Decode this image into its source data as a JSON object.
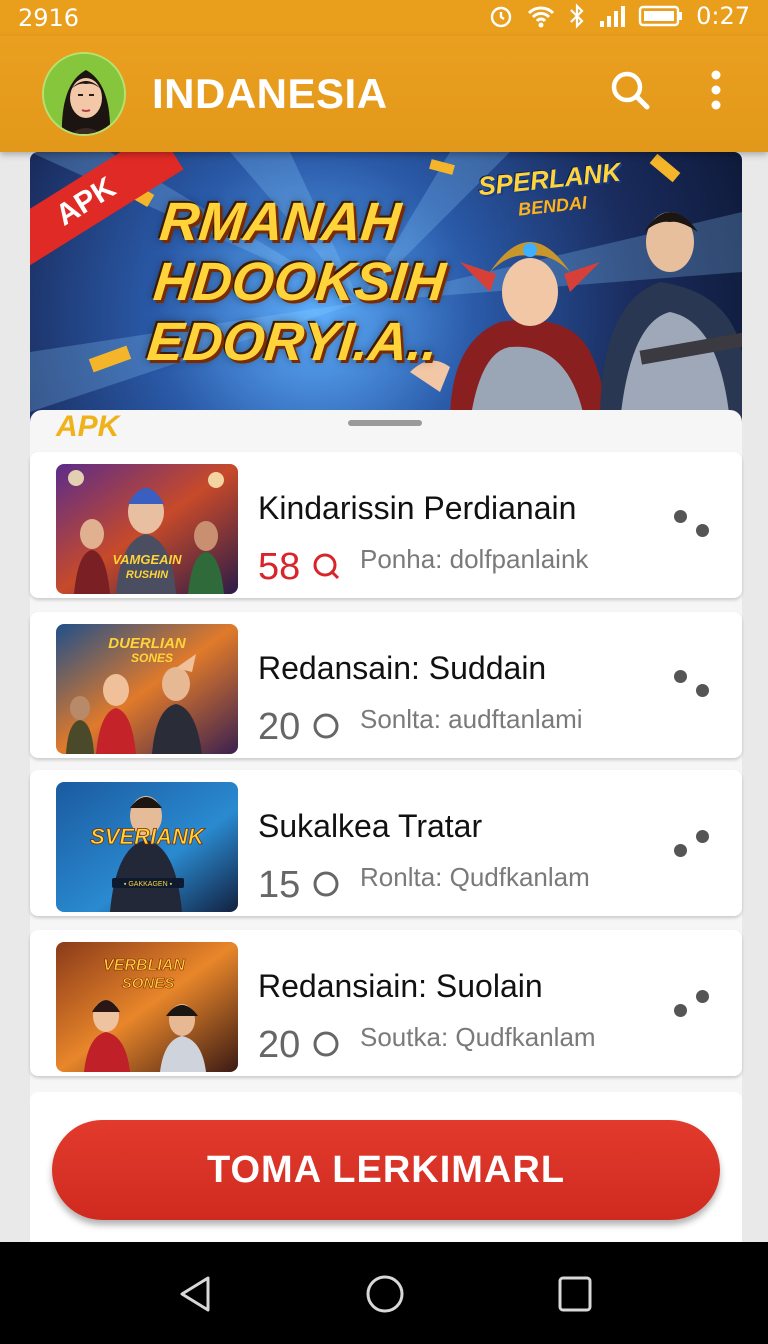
{
  "status_bar": {
    "left_text": "2916",
    "time": "0:27",
    "icons": [
      "alarm-icon",
      "wifi-icon",
      "bluetooth-icon",
      "signal-icon",
      "battery-icon"
    ]
  },
  "app_bar": {
    "title": "INDANESIA",
    "icons": [
      "avatar",
      "search-icon",
      "more-vert-icon"
    ]
  },
  "banner": {
    "ribbon": "APK",
    "headline": "RMANAH\nHDOOKSIH\nEDORYI.A..",
    "logo_top": "SPERLANK",
    "logo_bottom": "BENDAI"
  },
  "sheet": {
    "label": "APK"
  },
  "games": [
    {
      "title": "Kindarissin Perdianain",
      "score": "58",
      "score_color": "#d8242a",
      "subtitle": "Ponha: dolfpanlaink",
      "thumb_text": "VAMGEAIN\nRUSHIN"
    },
    {
      "title": "Redansain: Suddain",
      "score": "20",
      "score_color": "#666666",
      "subtitle": "Sonlta: audftanlami",
      "thumb_text": "DUERLIAN\nSONES"
    },
    {
      "title": "Sukalkea Tratar",
      "score": "15",
      "score_color": "#666666",
      "subtitle": "Ronlta: Qudfkanlam",
      "thumb_text": "SVERIANK"
    },
    {
      "title": "Redansiain: Suolain",
      "score": "20",
      "score_color": "#666666",
      "subtitle": "Soutka: Qudfkanlam",
      "thumb_text": "VERBLIAN\nSONES"
    }
  ],
  "cta": {
    "label": "TOMA LERKIMARL"
  },
  "nav": [
    "back-icon",
    "home-icon",
    "recents-icon"
  ],
  "colors": {
    "accent": "#e99e1c",
    "cta": "#d8302a",
    "score_highlight": "#d8242a"
  }
}
